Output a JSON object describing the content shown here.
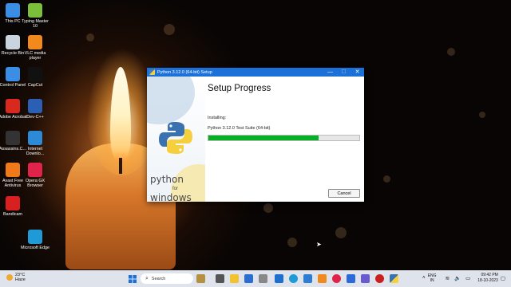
{
  "desktop_icons": [
    {
      "label": "This PC",
      "icon": "monitor-icon",
      "color": "#3a8ee6"
    },
    {
      "label": "Typing Master 10",
      "icon": "typing-master-icon",
      "color": "#7bbf3a"
    },
    {
      "label": "Recycle Bin",
      "icon": "recycle-bin-icon",
      "color": "#c9d4df"
    },
    {
      "label": "VLC media player",
      "icon": "vlc-icon",
      "color": "#f08a1c"
    },
    {
      "label": "Control Panel",
      "icon": "control-panel-icon",
      "color": "#3a8ee6"
    },
    {
      "label": "CapCut",
      "icon": "capcut-icon",
      "color": "#111111"
    },
    {
      "label": "Adobe Acrobat",
      "icon": "acrobat-icon",
      "color": "#d9281e"
    },
    {
      "label": "Dev-C++",
      "icon": "devcpp-icon",
      "color": "#2b5fb4"
    },
    {
      "label": "Assassins.C...",
      "icon": "assassins-creed-icon",
      "color": "#333333"
    },
    {
      "label": "Internet Downlo...",
      "icon": "idm-icon",
      "color": "#2c8ad6"
    },
    {
      "label": "Avast Free Antivirus",
      "icon": "avast-icon",
      "color": "#f07a1a"
    },
    {
      "label": "Opera GX Browser",
      "icon": "opera-gx-icon",
      "color": "#e0234a"
    },
    {
      "label": "Bandicam",
      "icon": "bandicam-icon",
      "color": "#d92020"
    },
    {
      "label": "Microsoft Edge",
      "icon": "edge-icon",
      "color": "#1f9ad6"
    }
  ],
  "window": {
    "title": "Python 3.12.0 (64-bit) Setup",
    "minimize": "—",
    "maximize": "☐",
    "close": "✕",
    "heading": "Setup Progress",
    "installing_label": "Installing:",
    "package_label": "Python 3.12.0 Test Suite (64-bit)",
    "progress_fraction": 0.73,
    "cancel_label": "Cancel",
    "brand_line1": "python",
    "brand_line2": "for",
    "brand_line3": "windows",
    "accent": "#1c71d8",
    "progress_color": "#06b025"
  },
  "taskbar": {
    "weather_temp": "23°C",
    "weather_desc": "Haze",
    "search_placeholder": "Search",
    "badge": "",
    "lang_line1": "ENG",
    "lang_line2": "IN",
    "time": "09:42 PM",
    "date": "18-10-2023"
  }
}
